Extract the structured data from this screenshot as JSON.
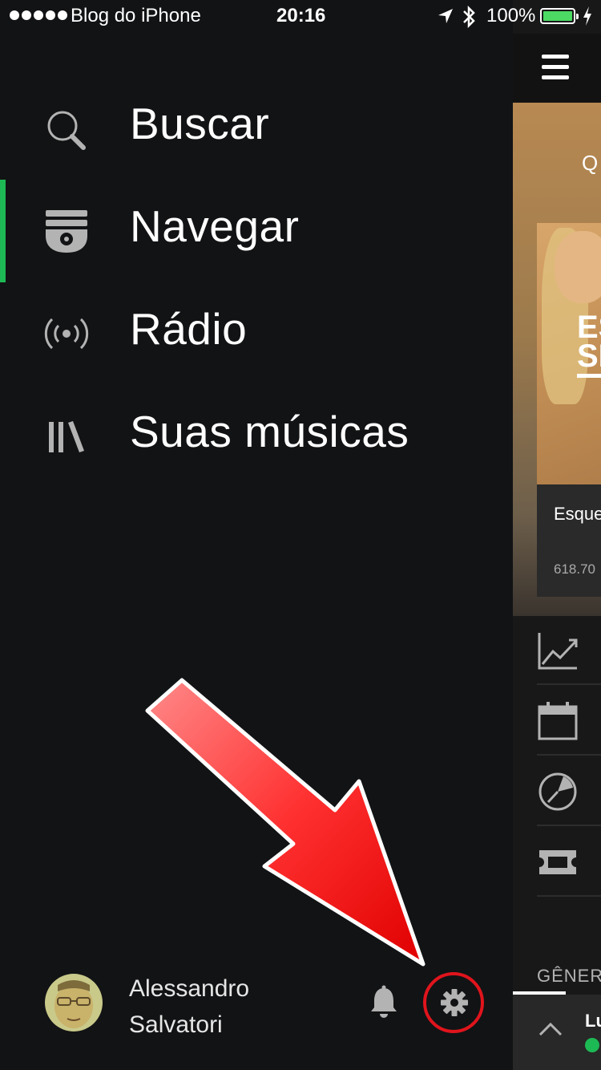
{
  "status_bar": {
    "carrier": "Blog do iPhone",
    "time": "20:16",
    "battery_percent": "100%",
    "battery_level": 1.0
  },
  "side_menu": {
    "items": [
      {
        "label": "Buscar",
        "icon": "search-icon"
      },
      {
        "label": "Navegar",
        "icon": "browse-icon",
        "active": true
      },
      {
        "label": "Rádio",
        "icon": "radio-icon"
      },
      {
        "label": "Suas músicas",
        "icon": "library-icon"
      }
    ],
    "active_color": "#1db954",
    "user": {
      "first_name": "Alessandro",
      "last_name": "Salvatori"
    },
    "notification_icon": "bell-icon",
    "settings_icon": "gear-icon",
    "highlight_color": "#e0141c"
  },
  "main_panel": {
    "header_letter": "Q",
    "featured": {
      "title": "Esque",
      "followers": "618.70"
    },
    "section_label": "GÊNER",
    "player": {
      "track": "Lu"
    }
  }
}
